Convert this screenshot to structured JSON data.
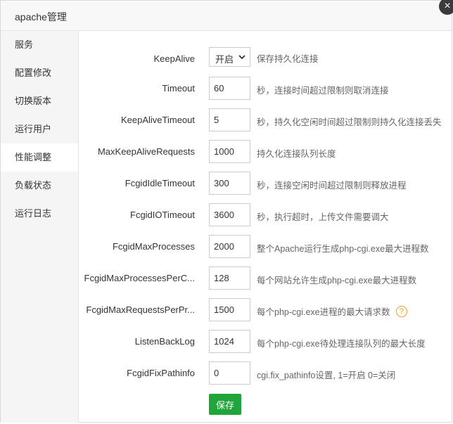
{
  "dialog": {
    "title": "apache管理",
    "close_symbol": "×"
  },
  "sidebar": {
    "items": [
      {
        "label": "服务"
      },
      {
        "label": "配置修改"
      },
      {
        "label": "切换版本"
      },
      {
        "label": "运行用户"
      },
      {
        "label": "性能调整",
        "active": true
      },
      {
        "label": "负载状态"
      },
      {
        "label": "运行日志"
      }
    ]
  },
  "form": {
    "rows": [
      {
        "label": "KeepAlive",
        "value": "开启",
        "desc": "保存持久化连接"
      },
      {
        "label": "Timeout",
        "value": "60",
        "desc": "秒，连接时间超过限制则取消连接"
      },
      {
        "label": "KeepAliveTimeout",
        "value": "5",
        "desc": "秒，持久化空闲时间超过限制则持久化连接丢失"
      },
      {
        "label": "MaxKeepAliveRequests",
        "value": "1000",
        "desc": "持久化连接队列长度"
      },
      {
        "label": "FcgidIdleTimeout",
        "value": "300",
        "desc": "秒，连接空闲时间超过限制则释放进程"
      },
      {
        "label": "FcgidIOTimeout",
        "value": "3600",
        "desc": "秒，执行超时，上传文件需要调大"
      },
      {
        "label": "FcgidMaxProcesses",
        "value": "2000",
        "desc": "整个Apache运行生成php-cgi.exe最大进程数"
      },
      {
        "label": "FcgidMaxProcessesPerC...",
        "value": "128",
        "desc": "每个网站允许生成php-cgi.exe最大进程数"
      },
      {
        "label": "FcgidMaxRequestsPerPr...",
        "value": "1500",
        "desc": "每个php-cgi.exe进程的最大请求数"
      },
      {
        "label": "ListenBackLog",
        "value": "1024",
        "desc": "每个php-cgi.exe待处理连接队列的最大长度"
      },
      {
        "label": "FcgidFixPathinfo",
        "value": "0",
        "desc": "cgi.fix_pathinfo设置, 1=开启 0=关闭"
      }
    ],
    "help_symbol": "?",
    "save_label": "保存"
  },
  "colors": {
    "accent": "#20a53a",
    "help": "#f0a020",
    "sidebar_bg": "#f5f5f5"
  },
  "icons": {
    "close": "close-icon",
    "dropdown": "chevron-down-icon",
    "help": "question-circle-icon"
  }
}
